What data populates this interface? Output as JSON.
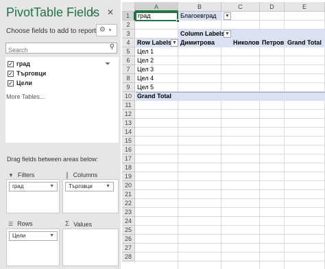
{
  "pane": {
    "title": "PivotTable Fields",
    "choose_label": "Choose fields to add to report:",
    "search_placeholder": "Search",
    "fields": [
      {
        "name": "град",
        "checked": true
      },
      {
        "name": "Търговци",
        "checked": true
      },
      {
        "name": "Цели",
        "checked": true
      }
    ],
    "more_tables": "More Tables...",
    "drag_label": "Drag fields between areas below:",
    "areas": {
      "filters": {
        "label": "Filters",
        "item": "град"
      },
      "columns": {
        "label": "Columns",
        "item": "Търговци"
      },
      "rows": {
        "label": "Rows",
        "item": "Цели"
      },
      "values": {
        "label": "Values"
      }
    }
  },
  "sheet": {
    "columns": [
      "A",
      "B",
      "C",
      "D",
      "E"
    ],
    "rows": [
      "1",
      "2",
      "3",
      "4",
      "5",
      "6",
      "7",
      "8",
      "9",
      "10",
      "11",
      "12",
      "13",
      "14",
      "15",
      "16",
      "17",
      "18",
      "19",
      "20",
      "21",
      "22",
      "23",
      "24",
      "25",
      "26",
      "27",
      "28"
    ],
    "cells": {
      "a1": "град",
      "b1": "Благоевград",
      "b3": "Column Labels",
      "a4": "Row Labels",
      "b4": "Димитрова",
      "c4": "Николов",
      "d4": "Петров",
      "e4": "Grand Total",
      "row_items": [
        "Цел 1",
        "Цел 2",
        "Цел 3",
        "Цел 4",
        "Цел 5"
      ],
      "a10": "Grand Total"
    }
  },
  "colors": {
    "accent": "#217346",
    "header_fill": "#d9e1f2"
  }
}
